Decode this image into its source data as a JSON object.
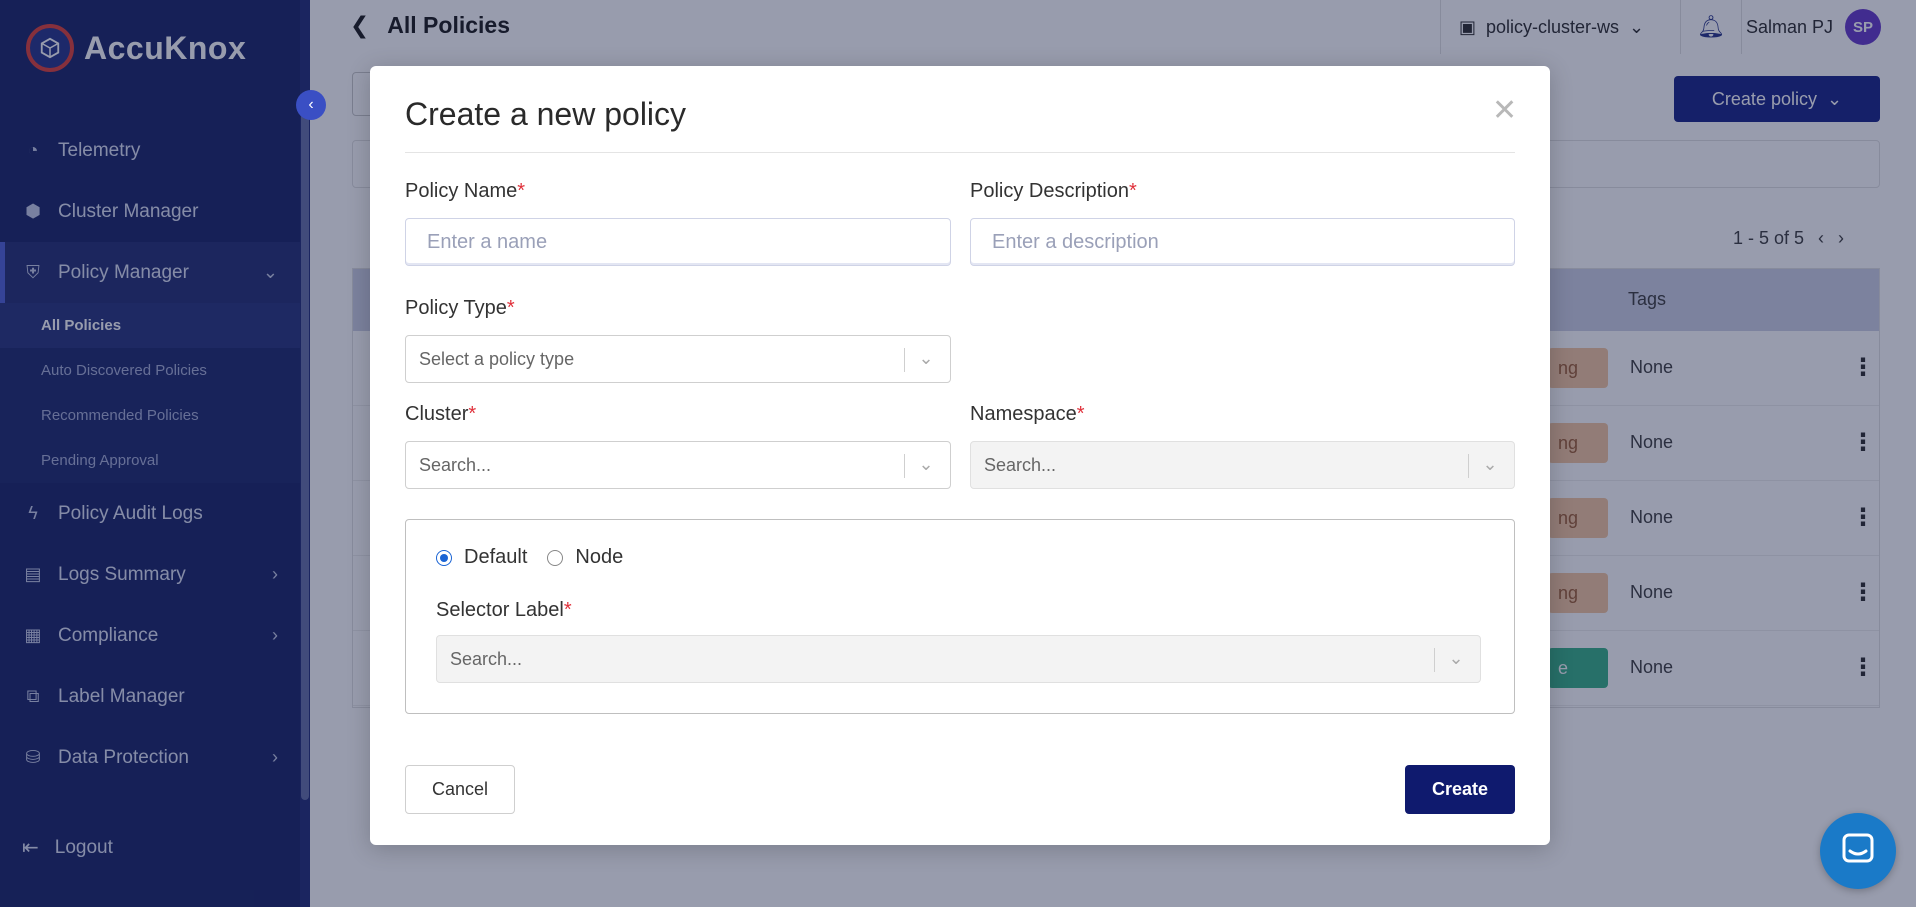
{
  "brand": {
    "name": "AccuKnox"
  },
  "sidebar": {
    "items": [
      {
        "label": "Telemetry",
        "icon": "telemetry-icon"
      },
      {
        "label": "Cluster Manager",
        "icon": "cluster-icon"
      },
      {
        "label": "Policy Manager",
        "icon": "shield-icon",
        "expanded": true
      },
      {
        "label": "Policy Audit Logs",
        "icon": "bolt-icon"
      },
      {
        "label": "Logs Summary",
        "icon": "logs-icon"
      },
      {
        "label": "Compliance",
        "icon": "compliance-icon"
      },
      {
        "label": "Label Manager",
        "icon": "label-icon"
      },
      {
        "label": "Data Protection",
        "icon": "data-protection-icon"
      }
    ],
    "subitems": [
      {
        "label": "All Policies",
        "active": true
      },
      {
        "label": "Auto Discovered Policies"
      },
      {
        "label": "Recommended Policies"
      },
      {
        "label": "Pending Approval"
      }
    ],
    "logout": "Logout"
  },
  "header": {
    "title": "All Policies",
    "cluster": "policy-cluster-ws",
    "user_name": "Salman PJ",
    "user_initials": "SP"
  },
  "background": {
    "create_policy_label": "Create policy",
    "pagination": "1 - 5 of 5",
    "tags_header": "Tags",
    "rows": [
      {
        "status": "ng",
        "tag": "None"
      },
      {
        "status": "ng",
        "tag": "None"
      },
      {
        "status": "ng",
        "tag": "None"
      },
      {
        "status": "ng",
        "tag": "None"
      },
      {
        "status": "e",
        "tag": "None"
      }
    ]
  },
  "modal": {
    "title": "Create a new policy",
    "policy_name": {
      "label": "Policy Name",
      "placeholder": "Enter a name",
      "value": ""
    },
    "policy_description": {
      "label": "Policy Description",
      "placeholder": "Enter a description",
      "value": ""
    },
    "policy_type": {
      "label": "Policy Type",
      "placeholder": "Select a policy type"
    },
    "cluster": {
      "label": "Cluster",
      "placeholder": "Search..."
    },
    "namespace": {
      "label": "Namespace",
      "placeholder": "Search..."
    },
    "mode": {
      "options": [
        "Default",
        "Node"
      ],
      "selected": "Default"
    },
    "selector_label": {
      "label": "Selector Label",
      "placeholder": "Search..."
    },
    "cancel_label": "Cancel",
    "create_label": "Create"
  },
  "colors": {
    "sidebar_bg": "#1f2a6b",
    "primary": "#0f1a6e",
    "required": "#e0303a",
    "radio_checked": "#1a64d4"
  }
}
